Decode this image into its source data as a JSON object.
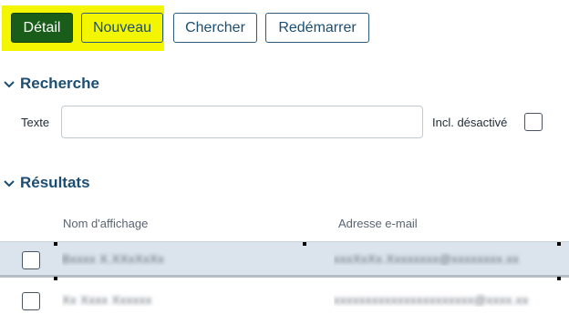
{
  "toolbar": {
    "detail_label": "Détail",
    "nouveau_label": "Nouveau",
    "chercher_label": "Chercher",
    "redemarrer_label": "Redémarrer"
  },
  "search": {
    "section_title": "Recherche",
    "texte_label": "Texte",
    "texte_value": "",
    "incl_label": "Incl. désactivé",
    "incl_checked": false
  },
  "results": {
    "section_title": "Résultats",
    "columns": [
      "Nom d'affichage",
      "Adresse e-mail"
    ],
    "rows": [
      {
        "name": "Bxxxx X.XXxXxXx",
        "email": "xxxXxXx.Xxxxxxxx@xxxxxxxx.xx",
        "selected": true
      },
      {
        "name": "Xx Xxxx Xxxxxx",
        "email": "xxxxxxxxxxxxxxxxxxxxxx@xxxx.xx",
        "selected": false
      }
    ]
  },
  "colors": {
    "accent": "#1c4d72",
    "detail_bg": "#1a5c1a",
    "highlight": "#f3f600",
    "selected_row": "#dbe4ec"
  }
}
